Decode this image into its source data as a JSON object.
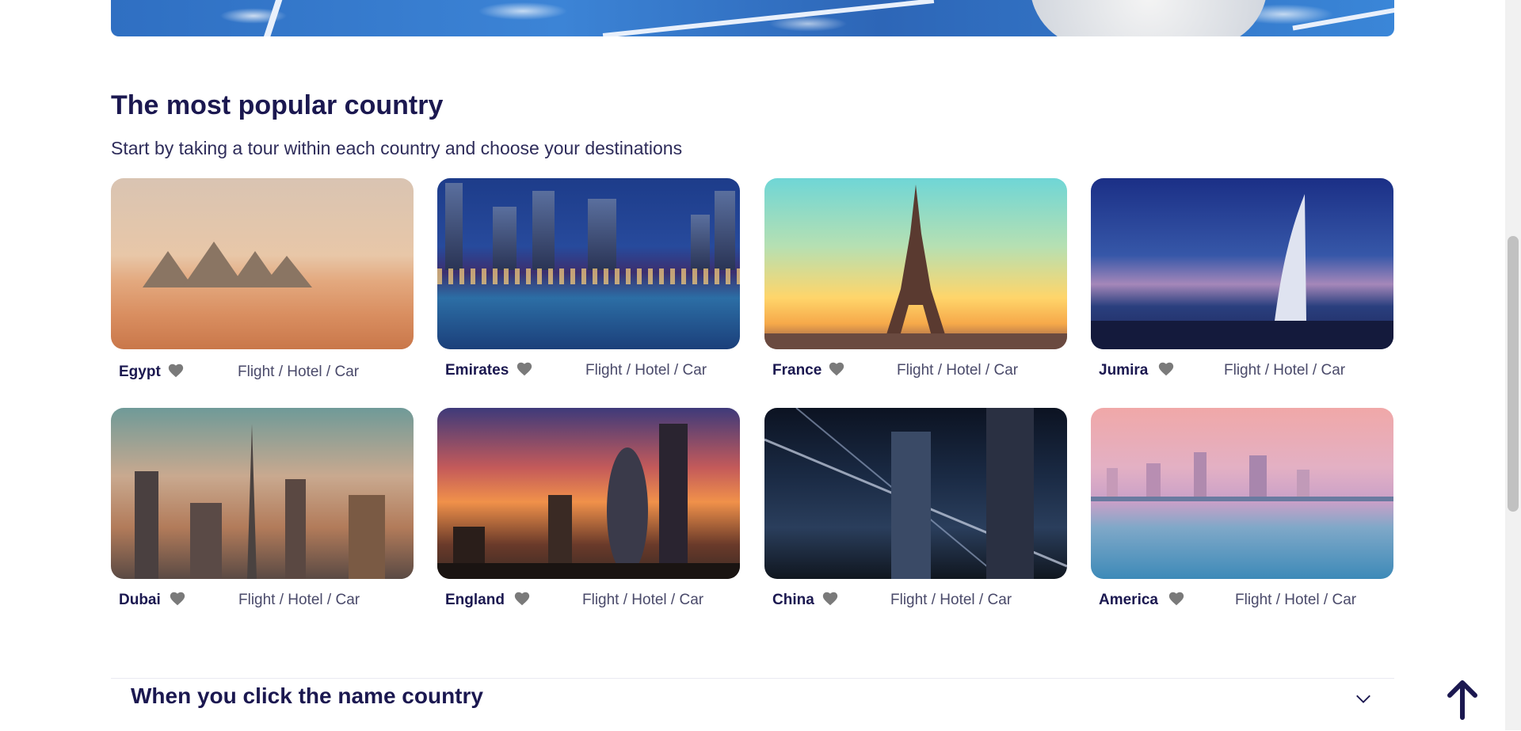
{
  "section": {
    "title": "The most popular country",
    "subtitle": "Start by taking a tour within each country and choose your destinations"
  },
  "countries": [
    {
      "name": "Egypt",
      "services": "Flight / Hotel / Car",
      "icon": "heart-icon"
    },
    {
      "name": "Emirates",
      "services": "Flight / Hotel / Car",
      "icon": "heart-icon"
    },
    {
      "name": "France",
      "services": "Flight / Hotel / Car",
      "icon": "heart-icon"
    },
    {
      "name": "Jumira",
      "services": "Flight / Hotel / Car",
      "icon": "heart-icon"
    },
    {
      "name": "Dubai",
      "services": "Flight / Hotel / Car",
      "icon": "heart-icon"
    },
    {
      "name": "England",
      "services": "Flight / Hotel / Car",
      "icon": "heart-icon"
    },
    {
      "name": "China",
      "services": "Flight / Hotel / Car",
      "icon": "heart-icon"
    },
    {
      "name": "America",
      "services": "Flight / Hotel / Car",
      "icon": "heart-icon"
    }
  ],
  "accordion": {
    "title": "When you click the name country",
    "icon": "chevron-down-icon"
  },
  "back_to_top": {
    "icon": "arrow-up-icon"
  },
  "colors": {
    "heading": "#1b1850",
    "heart": "#7a7a7a",
    "services_text": "#4a4a6a"
  }
}
